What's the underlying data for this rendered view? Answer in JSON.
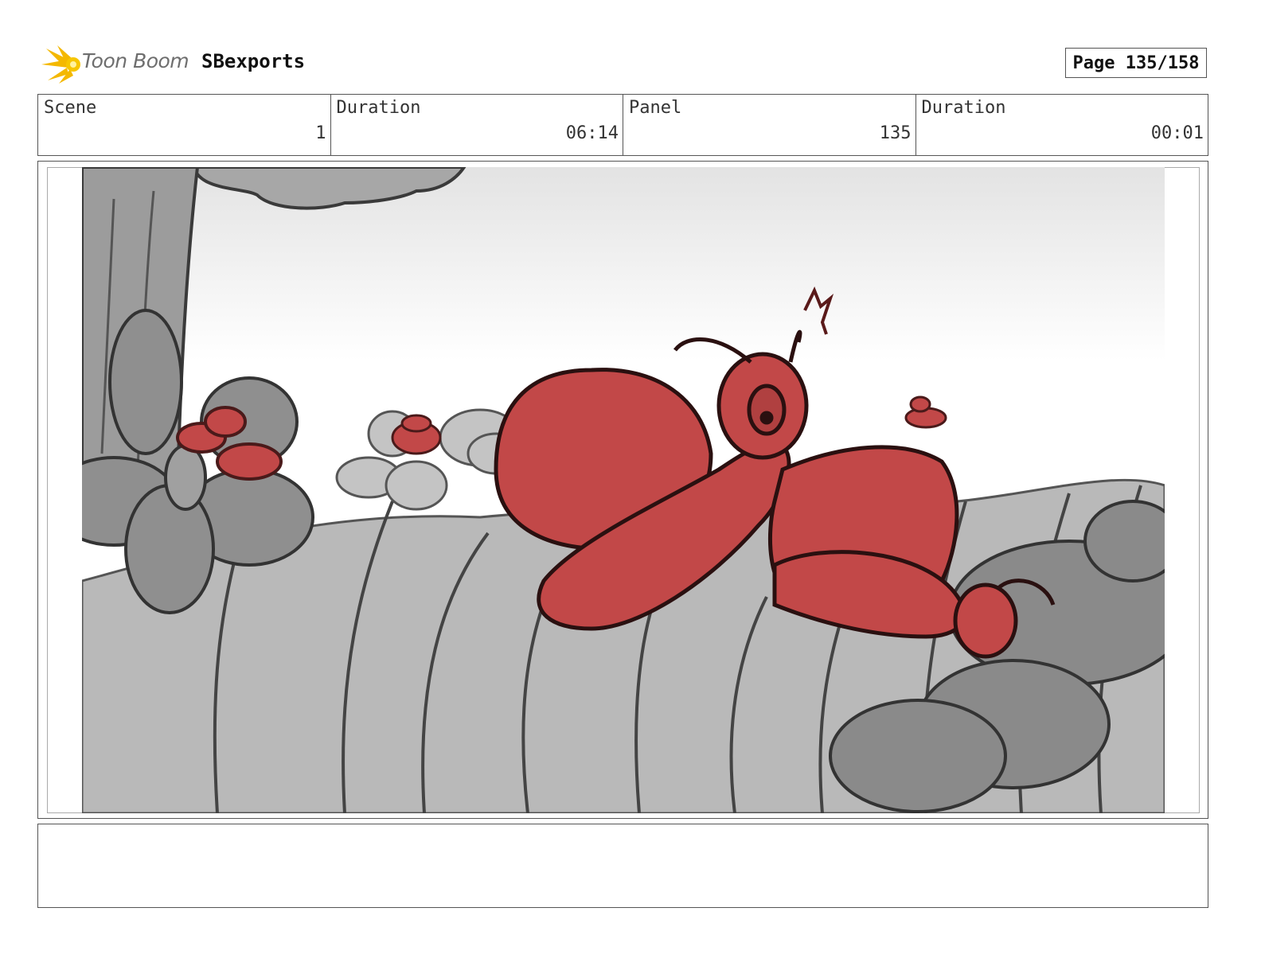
{
  "header": {
    "logo_text": "Toon Boom",
    "project_name": "SBexports",
    "page_label": "Page 135/158"
  },
  "info": {
    "scene_label": "Scene",
    "scene_value": "1",
    "scene_duration_label": "Duration",
    "scene_duration_value": "06:14",
    "panel_label": "Panel",
    "panel_value": "135",
    "panel_duration_label": "Duration",
    "panel_duration_value": "00:01"
  },
  "colors": {
    "character_red": "#c24848",
    "sketch_grey": "#9a9a9a",
    "line_dark": "#2a2a2a",
    "logo_yellow": "#f4b800"
  },
  "notes": {
    "text": ""
  }
}
